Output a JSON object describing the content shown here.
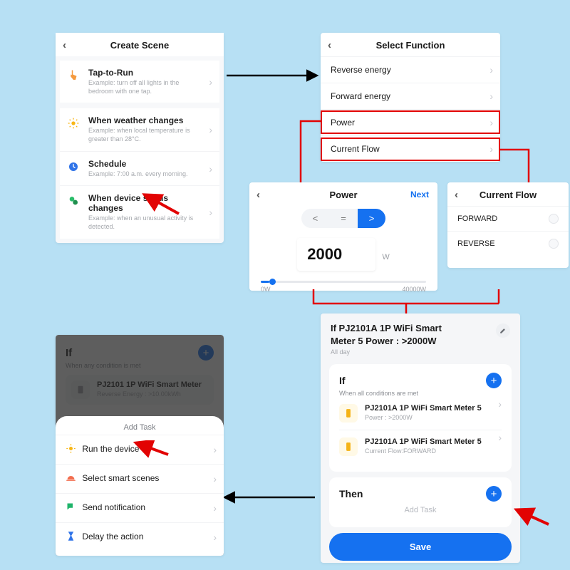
{
  "colors": {
    "accent": "#1571f0",
    "highlight": "#e20303"
  },
  "screen1": {
    "title": "Create Scene",
    "options": [
      {
        "title": "Tap-to-Run",
        "sub": "Example: turn off all lights in the bedroom with one tap."
      },
      {
        "title": "When weather changes",
        "sub": "Example: when local temperature is greater than 28°C."
      },
      {
        "title": "Schedule",
        "sub": "Example: 7:00 a.m. every morning."
      },
      {
        "title": "When device status changes",
        "sub": "Example: when an unusual activity is detected."
      }
    ]
  },
  "screen2": {
    "title": "Select Function",
    "rows": [
      "Reverse energy",
      "Forward energy",
      "Power",
      "Current Flow"
    ]
  },
  "screen3": {
    "title": "Power",
    "next": "Next",
    "ops": {
      "lt": "<",
      "eq": "=",
      "gt": ">",
      "active": ">"
    },
    "value": "2000",
    "unit": "W",
    "range_min": "0W",
    "range_max": "40000W"
  },
  "screen4": {
    "title": "Current Flow",
    "options": [
      "FORWARD",
      "REVERSE"
    ]
  },
  "screen5": {
    "heading_line1": "If PJ2101A 1P WiFi Smart",
    "heading_line2": "Meter  5 Power : >2000W",
    "subheading": "All day",
    "if_title": "If",
    "if_sub": "When all conditions are met",
    "conditions": [
      {
        "title": "PJ2101A 1P WiFi Smart Meter 5",
        "sub": "Power : >2000W"
      },
      {
        "title": "PJ2101A 1P WiFi Smart Meter 5",
        "sub": "Current Flow:FORWARD"
      }
    ],
    "then_title": "Then",
    "add_task": "Add Task",
    "save": "Save"
  },
  "screen6": {
    "if_title": "If",
    "if_sub": "When any condition is met",
    "device_line1": "PJ2101 1P WiFi Smart Meter",
    "device_line2": "Reverse Energy : >10.00kWh",
    "sheet_title": "Add Task",
    "tasks": [
      "Run the device",
      "Select smart scenes",
      "Send notification",
      "Delay the action"
    ]
  }
}
